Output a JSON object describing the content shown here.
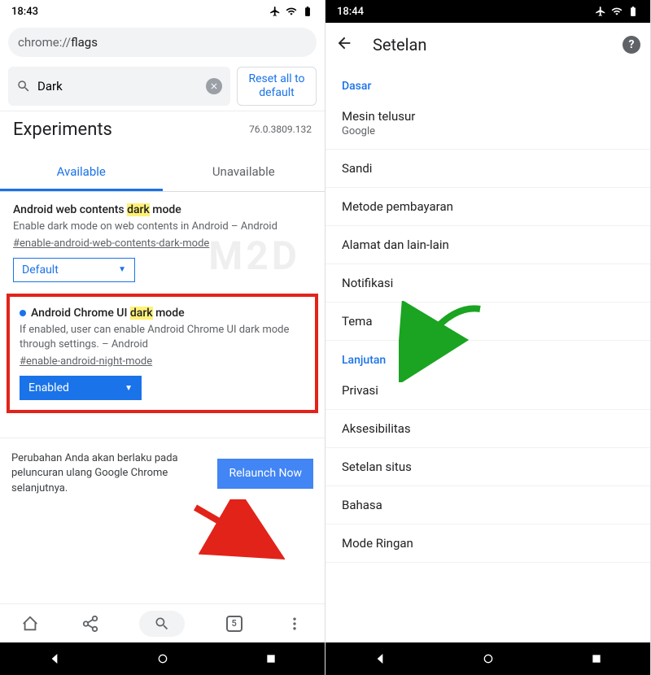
{
  "left": {
    "status": {
      "time": "18:43"
    },
    "url": {
      "host": "chrome://",
      "path": "flags"
    },
    "search": {
      "value": "Dark",
      "reset": "Reset all to default"
    },
    "experiments": {
      "title": "Experiments",
      "version": "76.0.3809.132"
    },
    "tabs": {
      "available": "Available",
      "unavailable": "Unavailable"
    },
    "flag1": {
      "title_pre": "Android web contents ",
      "title_hl": "dark",
      "title_post": " mode",
      "desc": "Enable dark mode on web contents in Android – Android",
      "link": "#enable-android-web-contents-dark-mode",
      "select": "Default"
    },
    "flag2": {
      "title_pre": "Android Chrome UI ",
      "title_hl": "dark",
      "title_post": " mode",
      "desc": "If enabled, user can enable Android Chrome UI dark mode through settings. – Android",
      "link": "#enable-android-night-mode",
      "select": "Enabled"
    },
    "relaunch": {
      "text": "Perubahan Anda akan berlaku pada peluncuran ulang Google Chrome selanjutnya.",
      "button": "Relaunch Now"
    },
    "tab_count": "5"
  },
  "right": {
    "status": {
      "time": "18:44"
    },
    "app_bar": {
      "title": "Setelan"
    },
    "sections": {
      "basic": "Dasar",
      "advanced": "Lanjutan"
    },
    "items": {
      "search_engine": {
        "title": "Mesin telusur",
        "sub": "Google"
      },
      "password": "Sandi",
      "payment": "Metode pembayaran",
      "address": "Alamat dan lain-lain",
      "notifications": "Notifikasi",
      "theme": "Tema",
      "privacy": "Privasi",
      "accessibility": "Aksesibilitas",
      "site": "Setelan situs",
      "language": "Bahasa",
      "lite": "Mode Ringan"
    }
  },
  "watermark": "M2D"
}
